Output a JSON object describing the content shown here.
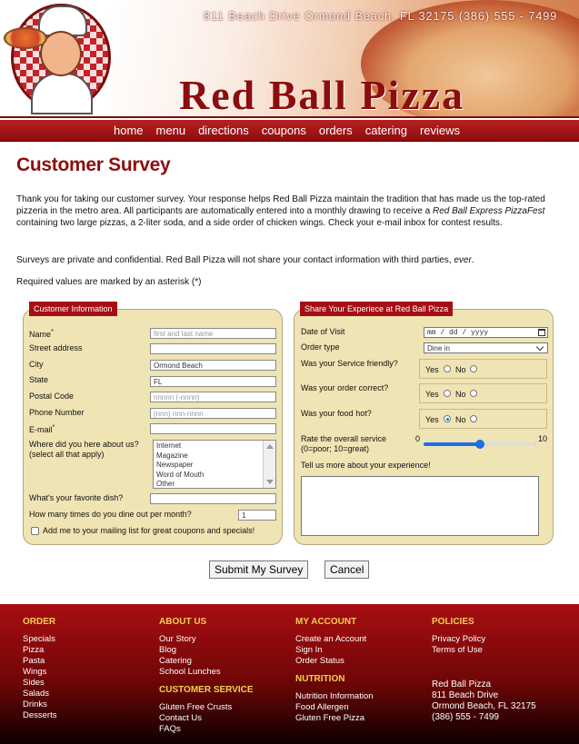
{
  "header": {
    "address": "811 Beach Drive  Ormond Beach, FL  32175   (386) 555 - 7499",
    "logo": "Red Ball Pizza"
  },
  "nav": [
    "home",
    "menu",
    "directions",
    "coupons",
    "orders",
    "catering",
    "reviews"
  ],
  "page": {
    "title": "Customer Survey",
    "intro_1a": "Thank you for taking our customer survey. Your response helps Red Ball Pizza maintain the tradition that has made us the top-rated pizzeria in the metro area. All participants are automatically entered into a monthly drawing to receive a ",
    "intro_1b": "Red Ball Express PizzaFest",
    "intro_1c": " containing two large pizzas, a 2-liter soda, and a side order of chicken wings. Check your e-mail inbox for contest results.",
    "intro_2a": "Surveys are private and confidential. Red Ball Pizza will not share your contact information with third parties, ",
    "intro_2b": "ever",
    "intro_2c": ".",
    "intro_3": "Required values are marked by an asterisk (*)"
  },
  "customer_info": {
    "title": "Customer Information",
    "name_label": "Name",
    "name_placeholder": "first and last name",
    "street_label": "Street address",
    "city_label": "City",
    "city_value": "Ormond Beach",
    "state_label": "State",
    "state_value": "FL",
    "postal_label": "Postal Code",
    "postal_placeholder": "nnnnn (-nnnn)",
    "phone_label": "Phone Number",
    "phone_placeholder": "(nnn) nnn-nnnn",
    "email_label": "E-mail",
    "asterisk": "*",
    "where_label_1": "Where did you here about us?",
    "where_label_2": "(select all that apply)",
    "where_options": [
      "Internet",
      "Magazine",
      "Newspaper",
      "Word of Mouth",
      "Other"
    ],
    "dish_label": "What's your favorite dish?",
    "dine_label": "How many times do you dine out per month?",
    "dine_value": "1",
    "mailing_label": "Add me to your mailing list for great coupons and specials!"
  },
  "experience": {
    "title": "Share Your Experiece at Red Ball Pizza",
    "date_label": "Date of Visit",
    "date_placeholder": "mm / dd / yyyy",
    "order_type_label": "Order type",
    "order_type_value": "Dine in",
    "service_label": "Was your Service friendly?",
    "correct_label": "Was your order correct?",
    "hot_label": "Was your food hot?",
    "yes": "Yes",
    "no": "No",
    "rate_label_1": "Rate the overall service",
    "rate_label_2": "(0=poor; 10=great)",
    "rate_min": "0",
    "rate_max": "10",
    "rate_value": 5,
    "comments_label": "Tell us more about your experience!"
  },
  "buttons": {
    "submit": "Submit My Survey",
    "cancel": "Cancel"
  },
  "footer": {
    "order_title": "ORDER",
    "order_items": [
      "Specials",
      "Pizza",
      "Pasta",
      "Wings",
      "Sides",
      "Salads",
      "Drinks",
      "Desserts"
    ],
    "about_title": "ABOUT US",
    "about_items": [
      "Our Story",
      "Blog",
      "Catering",
      "School Lunches"
    ],
    "service_title": "CUSTOMER SERVICE",
    "service_items": [
      "Gluten Free Crusts",
      "Contact Us",
      "FAQs"
    ],
    "account_title": "MY ACCOUNT",
    "account_items": [
      "Create an Account",
      "Sign In",
      "Order Status"
    ],
    "nutrition_title": "NUTRITION",
    "nutrition_items": [
      "Nutrition Information",
      "Food Allergen",
      "Gluten Free Pizza"
    ],
    "policies_title": "POLICIES",
    "policies_items": [
      "Privacy Policy",
      "Terms of Use"
    ],
    "address_lines": [
      "Red Ball Pizza",
      "811 Beach Drive",
      "Ormond Beach, FL 32175",
      "(386) 555 - 7499"
    ]
  }
}
